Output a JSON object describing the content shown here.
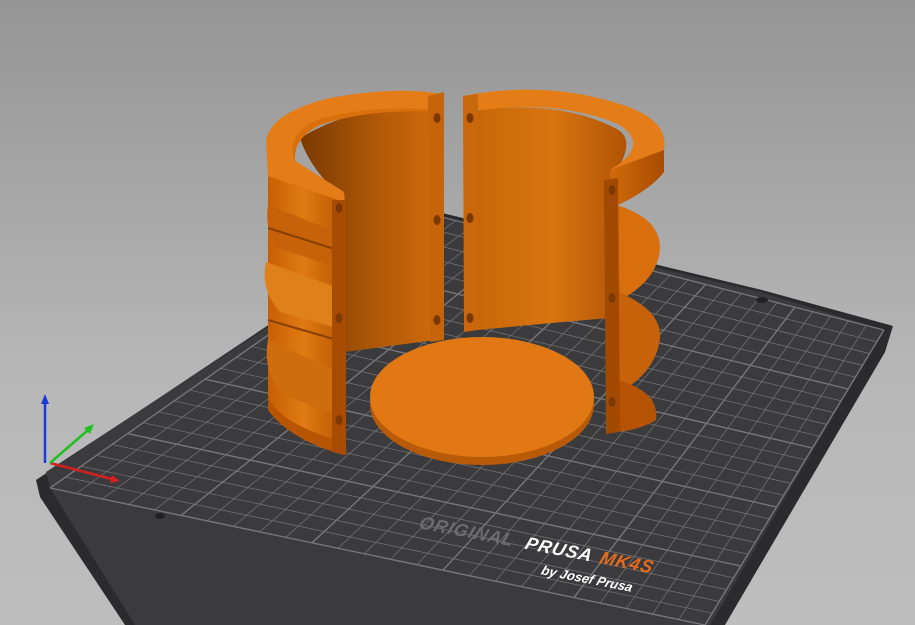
{
  "viewport": {
    "name": "3D build plate view"
  },
  "bed": {
    "brand_line1_prefix": "ORIGINAL",
    "brand_line1_name": "PRUSA",
    "brand_line1_model": "MK4S",
    "brand_line2": "by Josef Prusa",
    "colors": {
      "sheet": "#3b3b3d",
      "grid": "#8a8a8c",
      "accent": "#e66a1a"
    }
  },
  "objects": {
    "color": "#d9700c",
    "items": [
      "left-half-shell",
      "right-half-shell",
      "disc-lid"
    ]
  },
  "axes": {
    "x_color": "#d02020",
    "y_color": "#20c020",
    "z_color": "#1a3bd8"
  }
}
